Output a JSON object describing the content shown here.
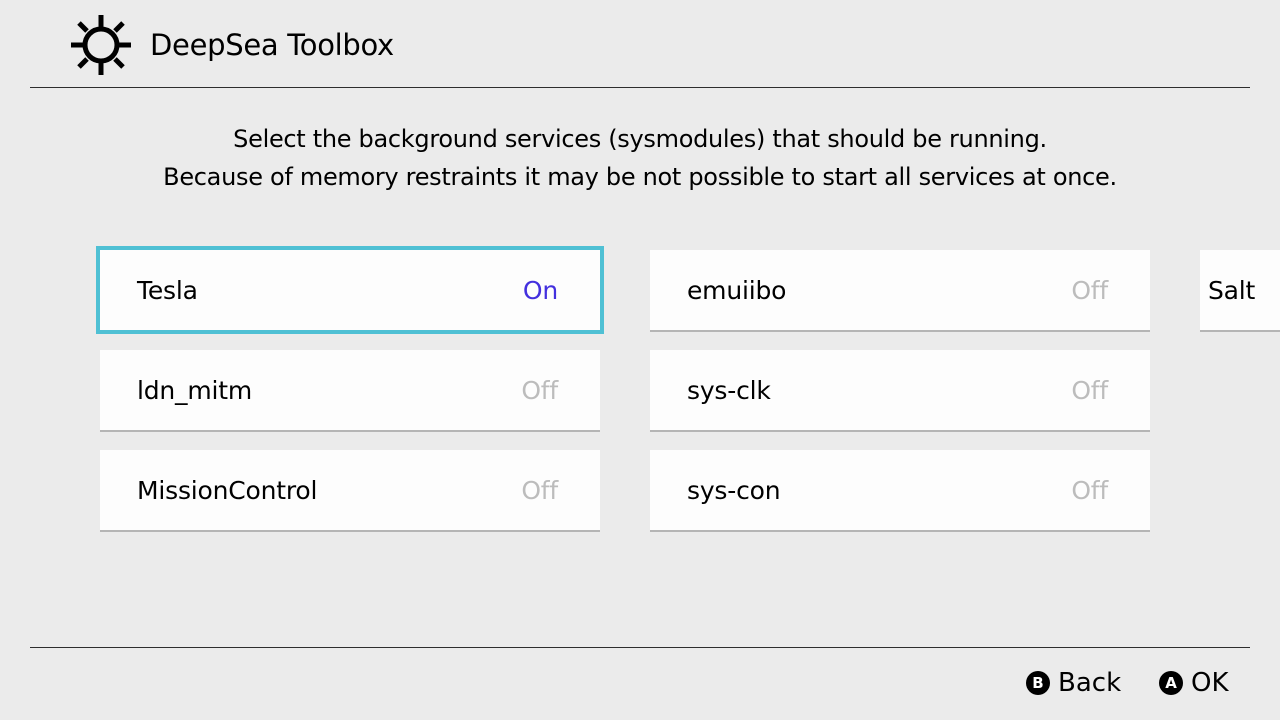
{
  "header": {
    "title": "DeepSea Toolbox",
    "icon": "gear-icon"
  },
  "description": {
    "line1": "Select the background services (sysmodules) that should be running.",
    "line2": "Because of memory restraints it may be not possible to start all services at once."
  },
  "services": [
    {
      "name": "Tesla",
      "status": "On",
      "focused": true
    },
    {
      "name": "ldn_mitm",
      "status": "Off"
    },
    {
      "name": "MissionControl",
      "status": "Off"
    },
    {
      "name": "emuiibo",
      "status": "Off"
    },
    {
      "name": "sys-clk",
      "status": "Off"
    },
    {
      "name": "sys-con",
      "status": "Off"
    },
    {
      "name": "Salt",
      "status": ""
    }
  ],
  "footer": {
    "back_icon": "B",
    "back_label": "Back",
    "ok_icon": "A",
    "ok_label": "OK"
  },
  "colors": {
    "on": "#4330de",
    "off": "#bcbcbc",
    "focus": "#4fc0d4"
  }
}
